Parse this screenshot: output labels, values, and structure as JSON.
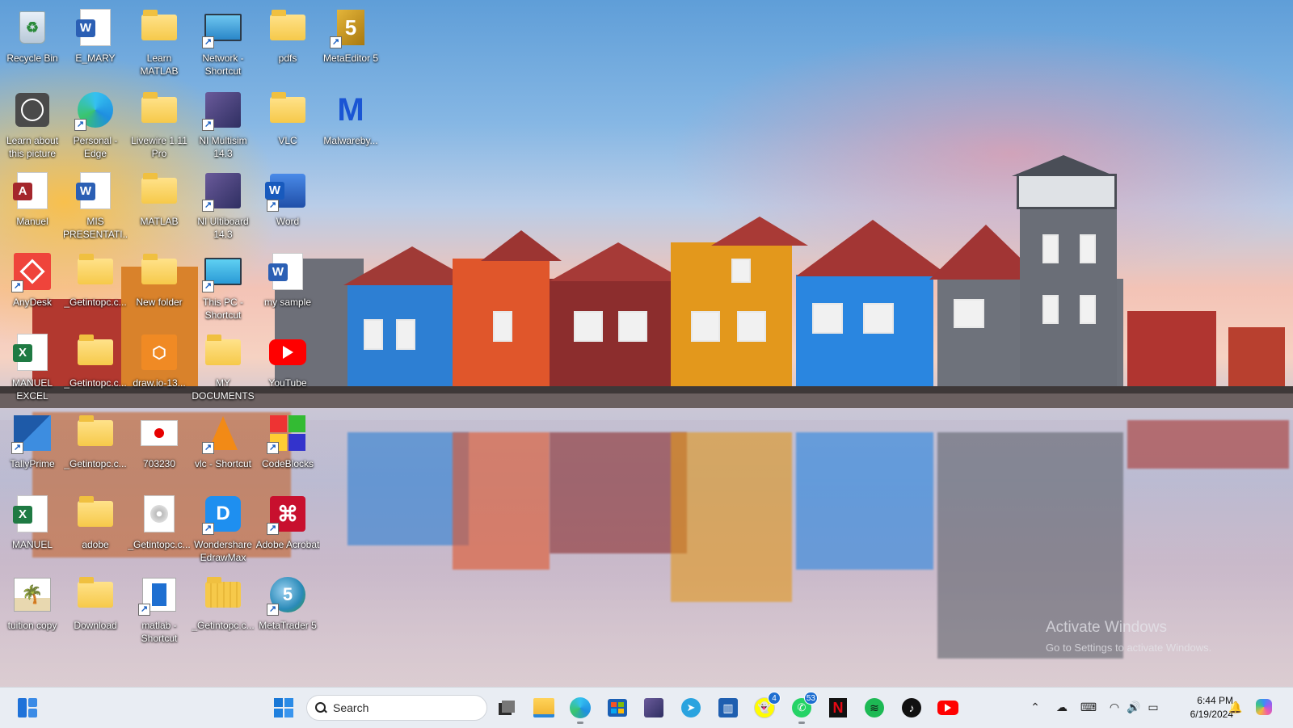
{
  "desktop": {
    "icons": [
      {
        "label": "Recycle Bin",
        "icon": "recycle-bin-icon"
      },
      {
        "label": "E_MARY",
        "icon": "word-document-icon"
      },
      {
        "label": "Learn MATLAB",
        "icon": "folder-icon"
      },
      {
        "label": "Network - Shortcut",
        "icon": "network-icon"
      },
      {
        "label": "pdfs",
        "icon": "folder-icon"
      },
      {
        "label": "MetaEditor 5",
        "icon": "metaeditor-icon"
      },
      {
        "label": "Learn about this picture",
        "icon": "camera-icon"
      },
      {
        "label": "Personal - Edge",
        "icon": "edge-icon"
      },
      {
        "label": "Livewire 1.11 Pro",
        "icon": "folder-icon"
      },
      {
        "label": "NI Multisim 14.3",
        "icon": "ni-multisim-icon"
      },
      {
        "label": "VLC",
        "icon": "folder-icon"
      },
      {
        "label": "Malwareby...",
        "icon": "malwarebytes-icon"
      },
      {
        "label": "Manuel",
        "icon": "access-icon"
      },
      {
        "label": "MIS PRESENTATI...",
        "icon": "word-document-icon"
      },
      {
        "label": "MATLAB",
        "icon": "folder-icon"
      },
      {
        "label": "NI Ultiboard 14.3",
        "icon": "ni-ultiboard-icon"
      },
      {
        "label": "Word",
        "icon": "word-icon"
      },
      {
        "label": "AnyDesk",
        "icon": "anydesk-icon"
      },
      {
        "label": "_Getintopc.c...",
        "icon": "folder-icon"
      },
      {
        "label": "New folder",
        "icon": "folder-icon"
      },
      {
        "label": "This PC - Shortcut",
        "icon": "this-pc-icon"
      },
      {
        "label": "my sample",
        "icon": "word-document-icon"
      },
      {
        "label": "MANUEL EXCEL",
        "icon": "excel-icon"
      },
      {
        "label": "_Getintopc.c...",
        "icon": "folder-icon"
      },
      {
        "label": "draw.io-13...",
        "icon": "drawio-icon"
      },
      {
        "label": "MY DOCUMENTS",
        "icon": "folder-icon"
      },
      {
        "label": "YouTube",
        "icon": "youtube-icon"
      },
      {
        "label": "TallyPrime",
        "icon": "tallyprime-icon"
      },
      {
        "label": "_Getintopc.c...",
        "icon": "folder-icon"
      },
      {
        "label": "703230",
        "icon": "vodafone-icon"
      },
      {
        "label": "vlc - Shortcut",
        "icon": "vlc-cone-icon"
      },
      {
        "label": "CodeBlocks",
        "icon": "codeblocks-icon"
      },
      {
        "label": "MANUEL",
        "icon": "excel-icon"
      },
      {
        "label": "adobe",
        "icon": "folder-icon"
      },
      {
        "label": "_Getintopc.c...",
        "icon": "disc-image-icon"
      },
      {
        "label": "Wondershare EdrawMax",
        "icon": "edrawmax-icon"
      },
      {
        "label": "Adobe Acrobat",
        "icon": "acrobat-icon"
      },
      {
        "label": "tuition copy",
        "icon": "picture-icon"
      },
      {
        "label": "Download",
        "icon": "folder-icon"
      },
      {
        "label": "matlab - Shortcut",
        "icon": "matlab-shortcut-icon"
      },
      {
        "label": "_Getintopc.c...",
        "icon": "zip-folder-icon"
      },
      {
        "label": "MetaTrader 5",
        "icon": "metatrader-icon"
      }
    ],
    "watermark": {
      "line1": "Activate Windows",
      "line2": "Go to Settings to activate Windows."
    }
  },
  "taskbar": {
    "search_placeholder": "Search",
    "apps": [
      {
        "name": "widgets",
        "icon": "widgets-icon"
      },
      {
        "name": "start",
        "icon": "windows-start-icon"
      },
      {
        "name": "task-view",
        "icon": "task-view-icon"
      },
      {
        "name": "file-explorer",
        "icon": "file-explorer-icon"
      },
      {
        "name": "edge",
        "icon": "edge-icon"
      },
      {
        "name": "microsoft-store",
        "icon": "store-icon"
      },
      {
        "name": "ni-multisim",
        "icon": "ni-multisim-icon"
      },
      {
        "name": "telegram",
        "icon": "telegram-icon"
      },
      {
        "name": "capcut",
        "icon": "capcut-icon"
      },
      {
        "name": "snapchat",
        "icon": "snapchat-icon"
      },
      {
        "name": "whatsapp",
        "icon": "whatsapp-icon"
      },
      {
        "name": "netflix",
        "icon": "netflix-icon"
      },
      {
        "name": "spotify",
        "icon": "spotify-icon"
      },
      {
        "name": "tiktok",
        "icon": "tiktok-icon"
      },
      {
        "name": "youtube",
        "icon": "youtube-icon"
      }
    ],
    "badges": {
      "snapchat": "4",
      "whatsapp": "53"
    },
    "clock": {
      "time": "6:44 PM",
      "date": "6/19/2024"
    }
  }
}
